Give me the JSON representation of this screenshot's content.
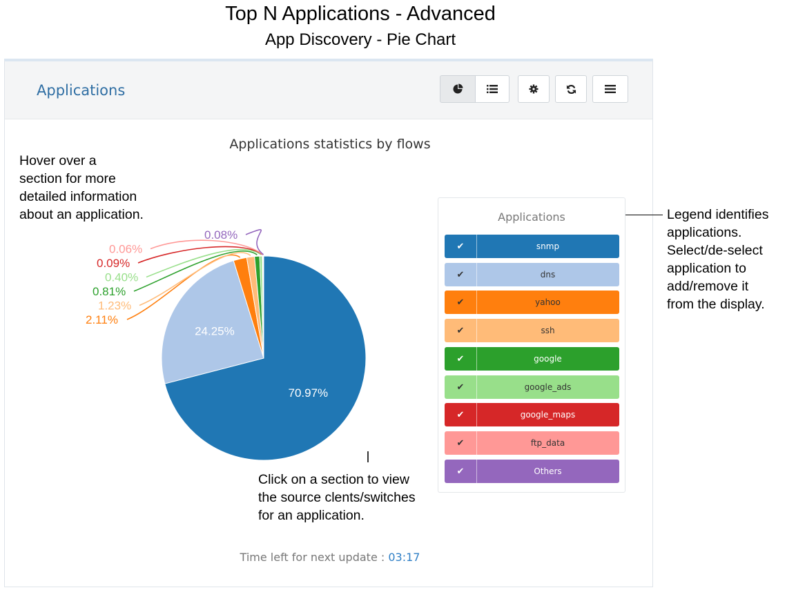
{
  "doc": {
    "title": "Top N Applications - Advanced",
    "subtitle": "App Discovery - Pie Chart"
  },
  "panel": {
    "title": "Applications",
    "toolbar": [
      {
        "name": "pie-chart-view-button",
        "icon": "pie-chart-icon",
        "active": true
      },
      {
        "name": "list-view-button",
        "icon": "list-icon",
        "active": false
      },
      {
        "name": "settings-button",
        "icon": "gear-icon",
        "active": false
      },
      {
        "name": "refresh-button",
        "icon": "refresh-icon",
        "active": false
      },
      {
        "name": "menu-button",
        "icon": "menu-icon",
        "active": false
      }
    ]
  },
  "chart_data": {
    "type": "pie",
    "title": "Applications statistics by flows",
    "slices": [
      {
        "label": "snmp",
        "value": 70.97,
        "display": "70.97%",
        "color": "#2077b4"
      },
      {
        "label": "dns",
        "value": 24.25,
        "display": "24.25%",
        "color": "#aec7e8"
      },
      {
        "label": "yahoo",
        "value": 2.11,
        "display": "2.11%",
        "color": "#ff7f0e"
      },
      {
        "label": "ssh",
        "value": 1.23,
        "display": "1.23%",
        "color": "#ffbb78"
      },
      {
        "label": "google",
        "value": 0.81,
        "display": "0.81%",
        "color": "#2ca02c"
      },
      {
        "label": "google_ads",
        "value": 0.4,
        "display": "0.40%",
        "color": "#98df8a"
      },
      {
        "label": "google_maps",
        "value": 0.09,
        "display": "0.09%",
        "color": "#d62728"
      },
      {
        "label": "ftp_data",
        "value": 0.06,
        "display": "0.06%",
        "color": "#ff9896"
      },
      {
        "label": "Others",
        "value": 0.08,
        "display": "0.08%",
        "color": "#9467bd"
      }
    ],
    "legend_title": "Applications",
    "legend_position": "right"
  },
  "legend": {
    "check_glyph": "✔",
    "text_colors": [
      "#ffffff",
      "#333333",
      "#333333",
      "#333333",
      "#ffffff",
      "#333333",
      "#ffffff",
      "#333333",
      "#ffffff"
    ]
  },
  "annotations": {
    "hover": "Hover over a\nsection for more\ndetailed information\nabout an application.",
    "legend": "Legend identifies\napplications.\nSelect/de-select\napplication to\nadd/remove it\nfrom the display.",
    "click": "Click on a section to view\nthe source clents/switches\nfor an application."
  },
  "footer": {
    "timer_label": "Time left for next update : ",
    "timer_value": "03:17"
  }
}
